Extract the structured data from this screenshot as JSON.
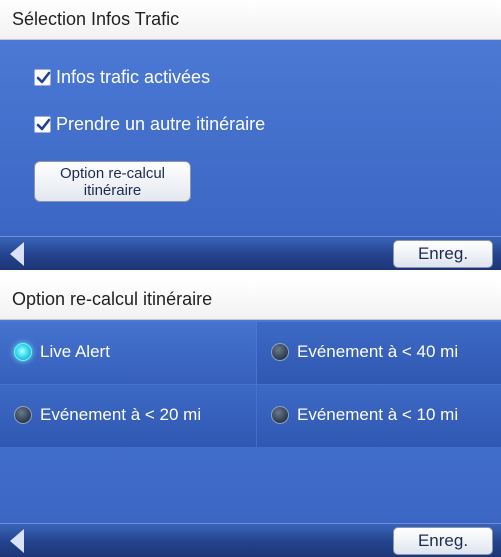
{
  "screen1": {
    "title": "Sélection Infos Trafic",
    "checkboxes": [
      {
        "label": "Infos trafic activées",
        "checked": true
      },
      {
        "label": "Prendre un autre itinéraire",
        "checked": true
      }
    ],
    "option_button": {
      "line1": "Option re-calcul",
      "line2": "itinéraire"
    },
    "save_label": "Enreg."
  },
  "screen2": {
    "title": "Option re-calcul itinéraire",
    "options": [
      {
        "label": "Live Alert",
        "selected": true
      },
      {
        "label": "Evénement à < 40 mi",
        "selected": false
      },
      {
        "label": "Evénement à < 20 mi",
        "selected": false
      },
      {
        "label": "Evénement à < 10 mi",
        "selected": false
      }
    ],
    "save_label": "Enreg."
  },
  "colors": {
    "content_blue": "#4b79d4",
    "bar_blue": "#24428c",
    "radio_on": "#36dff0"
  }
}
